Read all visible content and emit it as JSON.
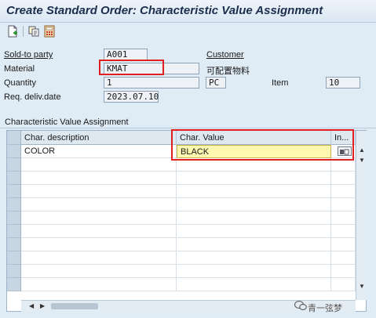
{
  "window": {
    "title": "Create Standard Order: Characteristic Value Assignment"
  },
  "toolbar": {
    "icons": [
      "create-item-icon",
      "copy-icon",
      "calculate-icon"
    ]
  },
  "header": {
    "sold_to_label": "Sold-to party",
    "sold_to_value": "A001",
    "sold_to_name": "Customer",
    "material_label": "Material",
    "material_value": "KMAT",
    "material_desc": "可配置物料",
    "quantity_label": "Quantity",
    "quantity_value": "1",
    "unit_value": "PC",
    "item_label": "Item",
    "item_value": "10",
    "deliv_date_label": "Req. deliv.date",
    "deliv_date_value": "2023.07.10"
  },
  "section": {
    "title": "Characteristic Value Assignment"
  },
  "table": {
    "columns": [
      "Char. description",
      "Char. Value",
      "In..."
    ],
    "rows": [
      {
        "description": "COLOR",
        "value": "BLACK"
      }
    ]
  },
  "watermark": {
    "text": "青一弦梦"
  },
  "colors": {
    "highlight": "#e02020",
    "input_active": "#fdf7b0",
    "background": "#dfebf5"
  }
}
